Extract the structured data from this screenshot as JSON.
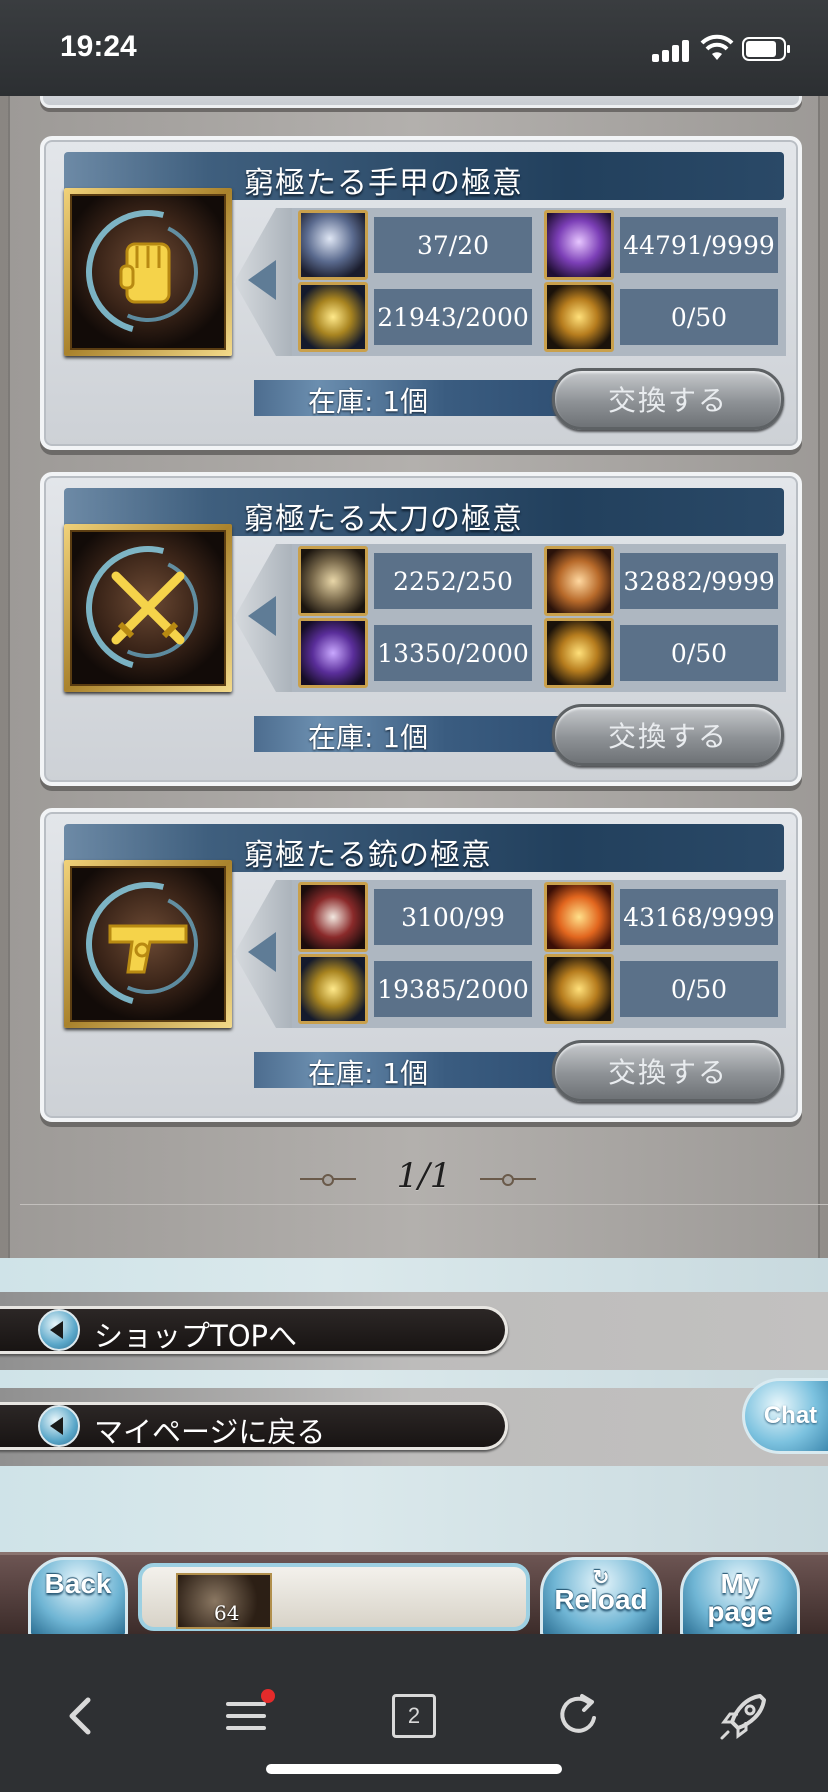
{
  "status_bar": {
    "time": "19:24"
  },
  "cards": [
    {
      "title": "窮極たる手甲の極意",
      "materials": [
        {
          "count": "37/20",
          "icon": "orb-icon"
        },
        {
          "count": "44791/9999",
          "icon": "purple-rose-icon"
        },
        {
          "count": "21943/2000",
          "icon": "gold-fragment-icon"
        },
        {
          "count": "0/50",
          "icon": "gold-crest-icon"
        }
      ],
      "stock": "在庫: 1個",
      "exchange_label": "交換する"
    },
    {
      "title": "窮極たる太刀の極意",
      "materials": [
        {
          "count": "2252/250",
          "icon": "gear-relic-icon"
        },
        {
          "count": "32882/9999",
          "icon": "flame-crystal-icon"
        },
        {
          "count": "13350/2000",
          "icon": "purple-crystal-icon"
        },
        {
          "count": "0/50",
          "icon": "gold-crest-icon"
        }
      ],
      "stock": "在庫: 1個",
      "exchange_label": "交換する"
    },
    {
      "title": "窮極たる銃の極意",
      "materials": [
        {
          "count": "3100/99",
          "icon": "tome-icon"
        },
        {
          "count": "43168/9999",
          "icon": "fire-rose-icon"
        },
        {
          "count": "19385/2000",
          "icon": "gold-fragment-icon"
        },
        {
          "count": "0/50",
          "icon": "gold-crest-icon"
        }
      ],
      "stock": "在庫: 1個",
      "exchange_label": "交換する"
    }
  ],
  "pagination": "1/1",
  "nav": {
    "shop_top": "ショップTOPへ",
    "my_page": "マイページに戻る"
  },
  "chat_label": "Chat",
  "game_bar": {
    "back": "Back",
    "reload": "Reload",
    "mypage_line1": "My",
    "mypage_line2": "page",
    "item_count": "64"
  },
  "browser": {
    "tab_count": "2"
  },
  "colors": {
    "title_bar": "#22405d",
    "count_box": "#5b7189",
    "notification_dot": "#e52b2b"
  }
}
